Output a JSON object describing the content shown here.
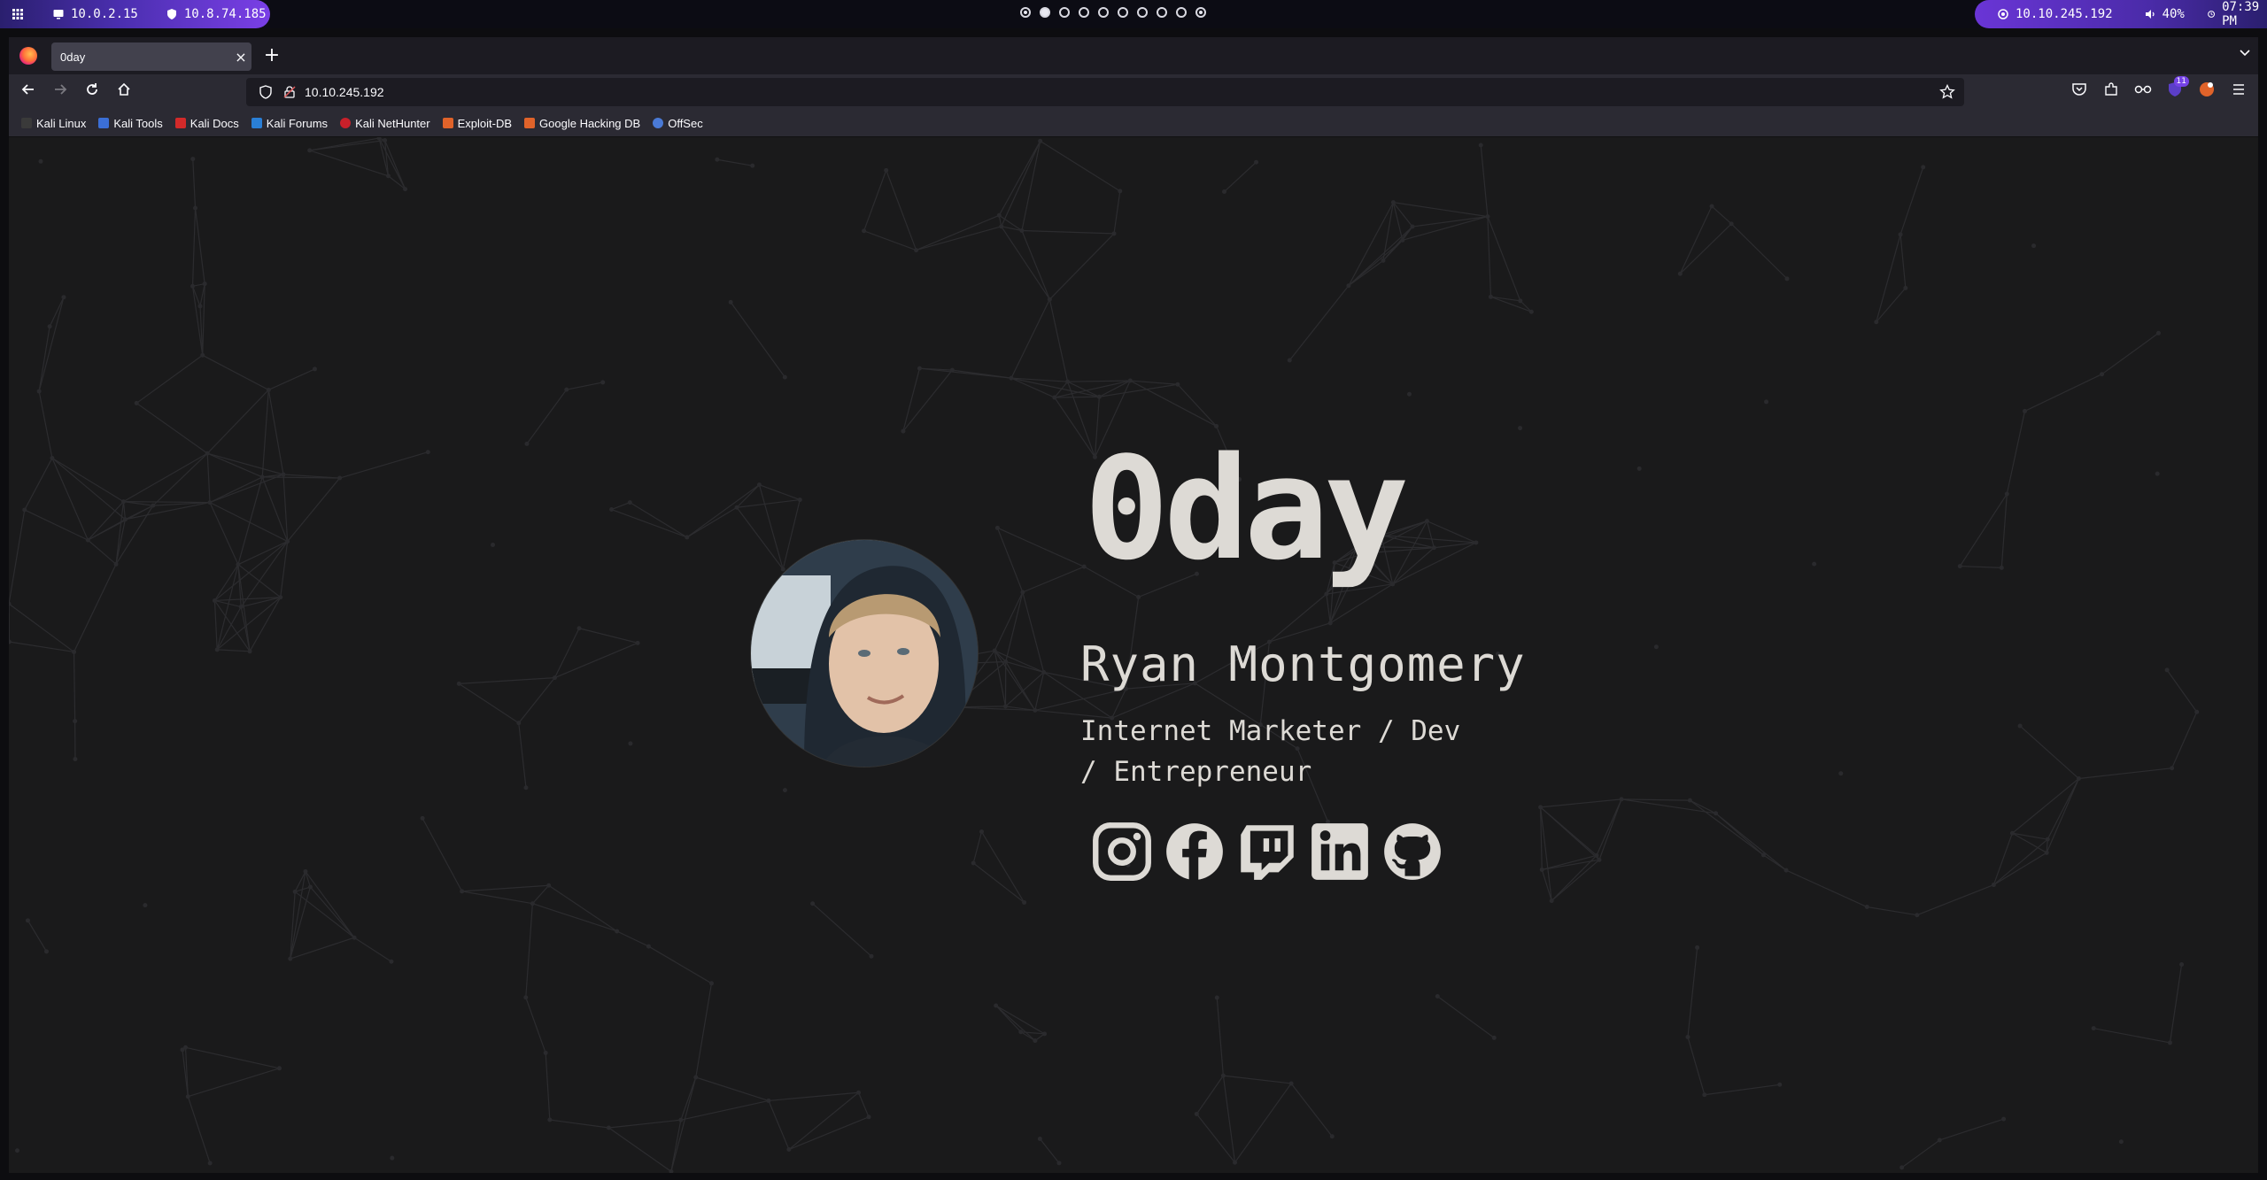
{
  "system_bar": {
    "left_items": [
      {
        "icon": "grid-menu-icon",
        "label": ""
      },
      {
        "icon": "monitor-icon",
        "label": "10.0.2.15"
      },
      {
        "icon": "shield-icon",
        "label": "10.8.74.185"
      }
    ],
    "workspaces": 10,
    "right_items": [
      {
        "icon": "target-icon",
        "label": "10.10.245.192"
      },
      {
        "icon": "volume-icon",
        "label": "40%"
      },
      {
        "icon": "clock-icon",
        "label": "07:39 PM"
      }
    ]
  },
  "browser": {
    "tab": {
      "title": "0day",
      "close": "×"
    },
    "new_tab": "+",
    "url": "10.10.245.192",
    "bookmarks": [
      {
        "label": "Kali Linux",
        "color": "#3a3a3a"
      },
      {
        "label": "Kali Tools",
        "color": "#3b6fd6"
      },
      {
        "label": "Kali Docs",
        "color": "#d22a2a"
      },
      {
        "label": "Kali Forums",
        "color": "#2a7fd6"
      },
      {
        "label": "Kali NetHunter",
        "color": "#c8202a"
      },
      {
        "label": "Exploit-DB",
        "color": "#e0632a"
      },
      {
        "label": "Google Hacking DB",
        "color": "#e0632a"
      },
      {
        "label": "OffSec",
        "color": "#4a7ad6"
      }
    ],
    "extension_badge": "11"
  },
  "page": {
    "brand": "0day",
    "name": "Ryan Montgomery",
    "tagline": "Internet Marketer / Dev / Entrepreneur",
    "socials": [
      "instagram-icon",
      "facebook-icon",
      "twitch-icon",
      "linkedin-icon",
      "github-icon"
    ]
  }
}
